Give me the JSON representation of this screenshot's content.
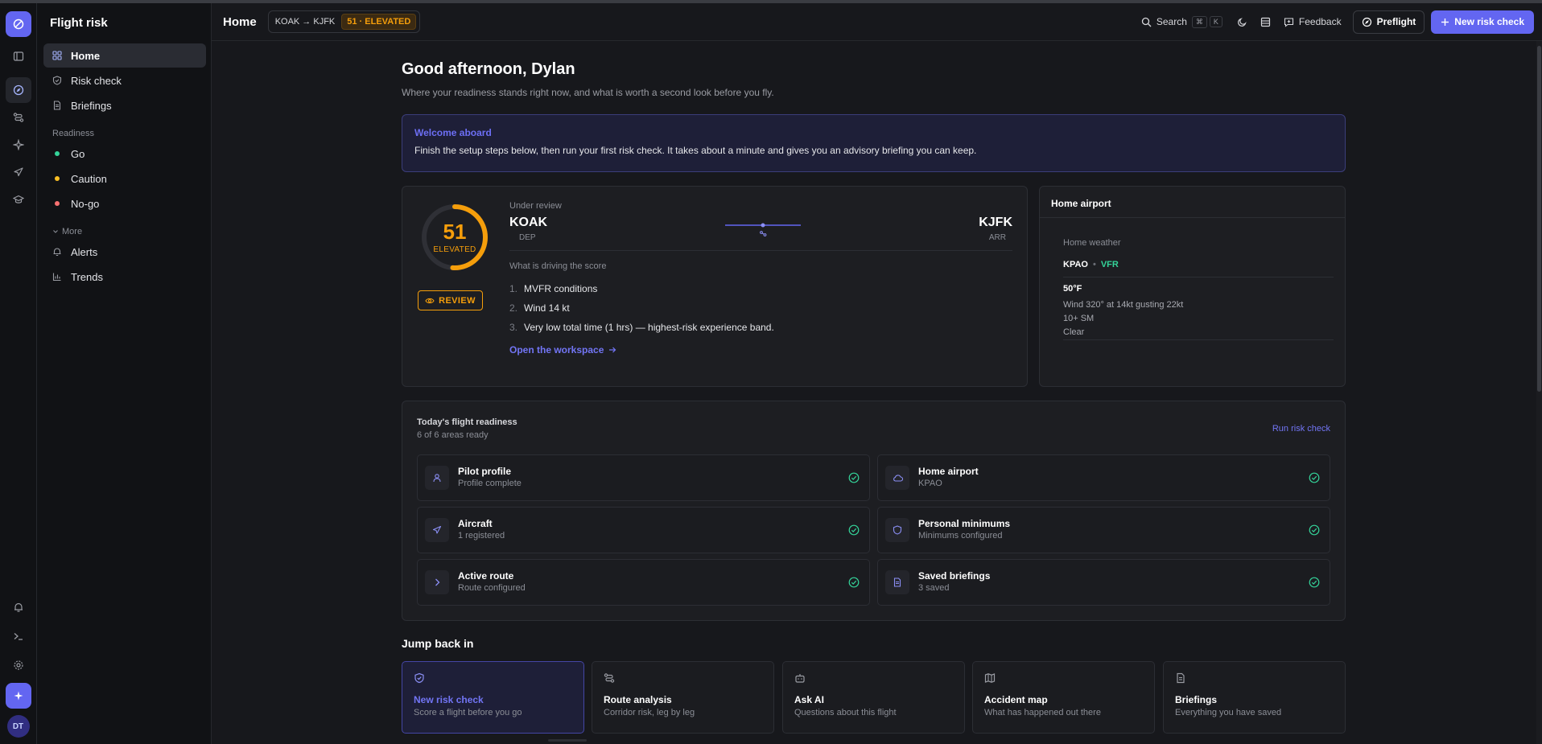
{
  "app": {
    "name": "Flight risk",
    "user_initials": "DT"
  },
  "colors": {
    "accent": "#6366f1",
    "elevated": "#f59e0b",
    "go": "#34d399",
    "caution": "#fbbf24",
    "nogo": "#f87171"
  },
  "sidebar": {
    "items": [
      {
        "label": "Home",
        "icon": "grid-icon",
        "active": true
      },
      {
        "label": "Risk check",
        "icon": "shield-icon"
      },
      {
        "label": "Briefings",
        "icon": "document-icon"
      }
    ],
    "readiness_label": "Readiness",
    "readiness": [
      {
        "label": "Go",
        "color": "#34d399"
      },
      {
        "label": "Caution",
        "color": "#fbbf24"
      },
      {
        "label": "No-go",
        "color": "#f87171"
      }
    ],
    "more_label": "More",
    "more": [
      {
        "label": "Alerts",
        "icon": "bell-icon"
      },
      {
        "label": "Trends",
        "icon": "bar-chart-icon"
      }
    ]
  },
  "header": {
    "title": "Home",
    "route": "KOAK → KJFK",
    "risk_badge": "51 · ELEVATED",
    "search_label": "Search",
    "search_kbd1": "⌘",
    "search_kbd2": "K",
    "feedback_label": "Feedback",
    "preflight_label": "Preflight",
    "new_check_label": "New risk check"
  },
  "main": {
    "greeting": "Good afternoon, Dylan",
    "subtitle": "Where your readiness stands right now, and what is worth a second look before you fly.",
    "welcome": {
      "title": "Welcome aboard",
      "body": "Finish the setup steps below, then run your first risk check. It takes about a minute and gives you an advisory briefing you can keep."
    },
    "risk": {
      "score": "51",
      "score_value": 51,
      "level": "ELEVATED",
      "review_label": "REVIEW",
      "under_review": "Under review",
      "departure": {
        "code": "KOAK",
        "role": "DEP"
      },
      "arrival": {
        "code": "KJFK",
        "role": "ARR"
      },
      "drivers_label": "What is driving the score",
      "drivers": [
        {
          "n": "1.",
          "text": "MVFR conditions"
        },
        {
          "n": "2.",
          "text": "Wind 14 kt"
        },
        {
          "n": "3.",
          "text": "Very low total time (1 hrs) — highest-risk experience band."
        }
      ],
      "workspace_link": "Open the workspace"
    },
    "home_airport": {
      "title": "Home airport",
      "weather_label": "Home weather",
      "station": "KPAO",
      "sep": "•",
      "category": "VFR",
      "temp": "50°F",
      "wind": "Wind 320° at 14kt gusting 22kt",
      "visibility": "10+ SM",
      "sky": "Clear"
    },
    "readiness": {
      "title": "Today's flight readiness",
      "subtitle": "6 of 6 areas ready",
      "run_label": "Run risk check",
      "tiles": [
        {
          "name": "Pilot profile",
          "sub": "Profile complete",
          "icon": "user-icon"
        },
        {
          "name": "Home airport",
          "sub": "KPAO",
          "icon": "cloud-icon"
        },
        {
          "name": "Aircraft",
          "sub": "1 registered",
          "icon": "plane-icon"
        },
        {
          "name": "Personal minimums",
          "sub": "Minimums configured",
          "icon": "shield-icon"
        },
        {
          "name": "Active route",
          "sub": "Route configured",
          "icon": "chevron-right-icon"
        },
        {
          "name": "Saved briefings",
          "sub": "3 saved",
          "icon": "document-icon"
        }
      ]
    },
    "jump": {
      "title": "Jump back in",
      "cards": [
        {
          "name": "New risk check",
          "sub": "Score a flight before you go",
          "icon": "shield-check-icon",
          "active": true
        },
        {
          "name": "Route analysis",
          "sub": "Corridor risk, leg by leg",
          "icon": "route-icon"
        },
        {
          "name": "Ask AI",
          "sub": "Questions about this flight",
          "icon": "bot-icon"
        },
        {
          "name": "Accident map",
          "sub": "What has happened out there",
          "icon": "map-icon"
        },
        {
          "name": "Briefings",
          "sub": "Everything you have saved",
          "icon": "document-icon"
        }
      ]
    }
  }
}
